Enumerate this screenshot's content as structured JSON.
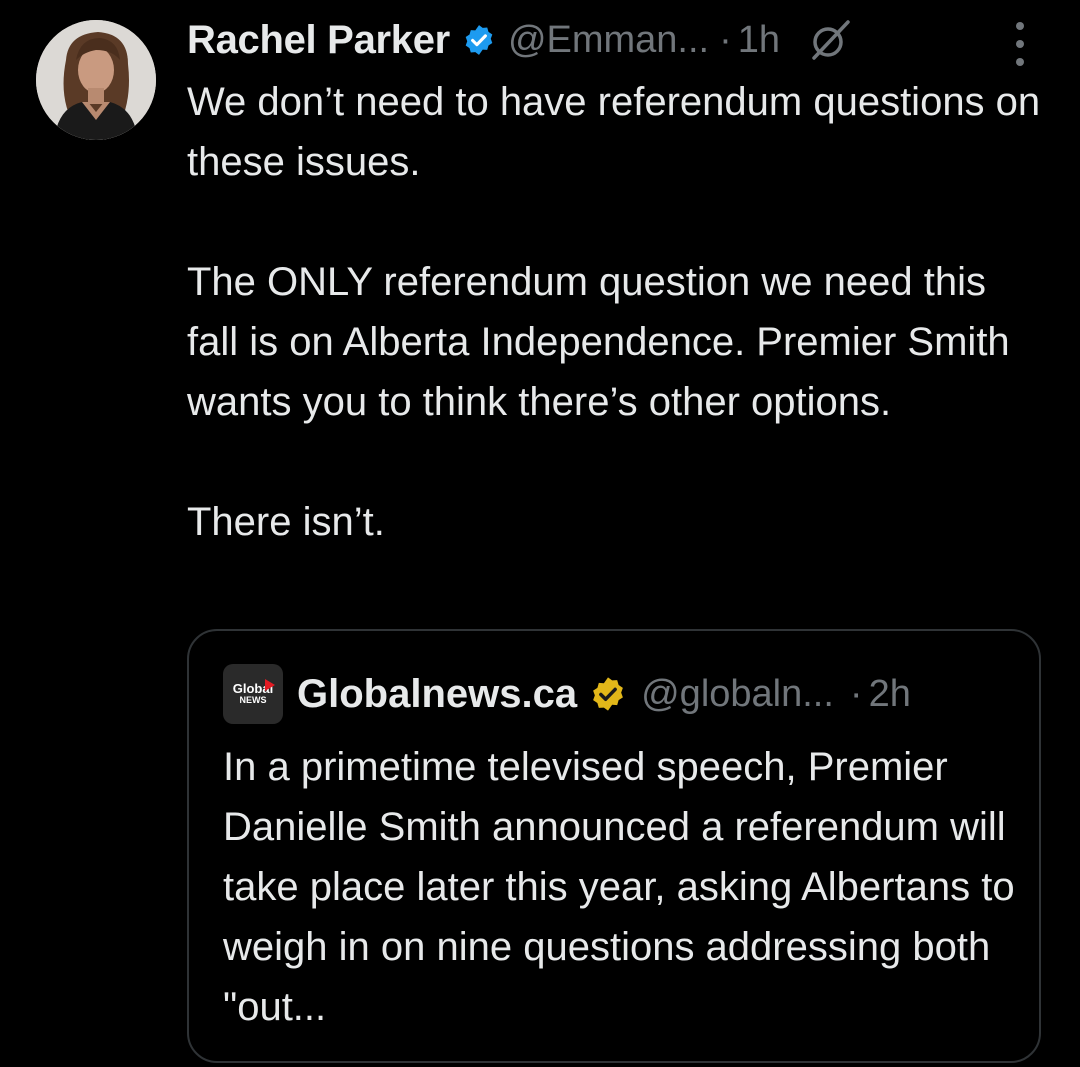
{
  "tweet": {
    "author": {
      "display_name": "Rachel Parker",
      "handle": "@Emman...",
      "verified_icon": "blue-check-icon",
      "avatar": "profile-photo"
    },
    "separator": "·",
    "time": "1h",
    "grok_icon": "grok-icon",
    "more_icon": "more-vertical-icon",
    "text": {
      "p1": "We don’t need to have referendum questions on these issues.",
      "p2": "The ONLY referendum question we need this fall is on Alberta Independence. Premier Smith wants you to think there’s other options.",
      "p3": "There isn’t."
    },
    "quote": {
      "author": {
        "display_name": "Globalnews.ca",
        "handle": "@globaln...",
        "verified_icon": "gold-check-icon",
        "logo_line1": "Global",
        "logo_line2": "NEWS"
      },
      "separator": "·",
      "time": "2h",
      "text": "In a primetime televised speech, Premier Danielle Smith announced a referendum will take place later this year, asking Albertans to weigh in on nine questions addressing both \"out..."
    }
  },
  "colors": {
    "background": "#000000",
    "text_primary": "#e7e9ea",
    "text_secondary": "#71767b",
    "border": "#2f3336",
    "verified_blue": "#1d9bf0",
    "verified_gold": "#e2b719",
    "global_logo_red": "#e31b23"
  }
}
